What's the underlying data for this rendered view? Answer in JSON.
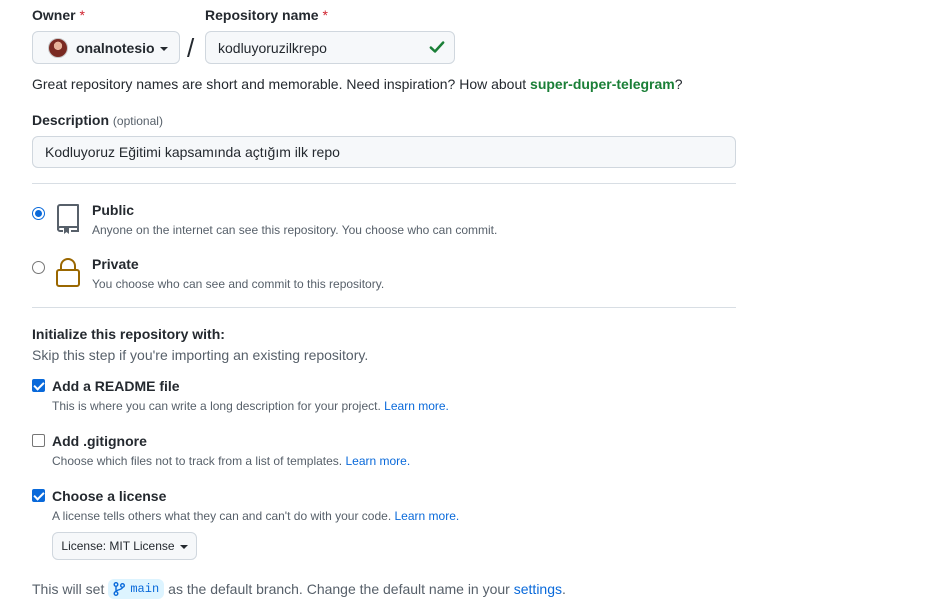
{
  "owner": {
    "label": "Owner",
    "required_mark": "*",
    "name": "onalnotesio"
  },
  "separator": "/",
  "repository": {
    "label": "Repository name",
    "required_mark": "*",
    "value": "kodluyoruzilkrepo"
  },
  "hint": {
    "text": "Great repository names are short and memorable. Need inspiration? How about ",
    "suggestion": "super-duper-telegram",
    "end": "?"
  },
  "description": {
    "label": "Description",
    "optional": "(optional)",
    "value": "Kodluyoruz Eğitimi kapsamında açtığım ilk repo"
  },
  "visibility": {
    "options": [
      {
        "title": "Public",
        "desc": "Anyone on the internet can see this repository. You choose who can commit.",
        "selected": true,
        "icon": "repo-icon"
      },
      {
        "title": "Private",
        "desc": "You choose who can see and commit to this repository.",
        "selected": false,
        "icon": "lock-icon"
      }
    ]
  },
  "init": {
    "title": "Initialize this repository with:",
    "subtitle": "Skip this step if you're importing an existing repository.",
    "options": [
      {
        "title": "Add a README file",
        "desc": "This is where you can write a long description for your project.",
        "link": "Learn more.",
        "checked": true
      },
      {
        "title": "Add .gitignore",
        "desc": "Choose which files not to track from a list of templates.",
        "link": "Learn more.",
        "checked": false
      },
      {
        "title": "Choose a license",
        "desc": "A license tells others what they can and can't do with your code.",
        "link": "Learn more.",
        "checked": true
      }
    ],
    "license_button": "License: MIT License"
  },
  "footer": {
    "prefix": "This will set",
    "branch": "main",
    "middle": "as the default branch. Change the default name in your",
    "link": "settings",
    "end": "."
  },
  "colors": {
    "accent": "#0969da",
    "success": "#1a7f37",
    "required": "#cf222e",
    "lock": "#9a6700"
  }
}
